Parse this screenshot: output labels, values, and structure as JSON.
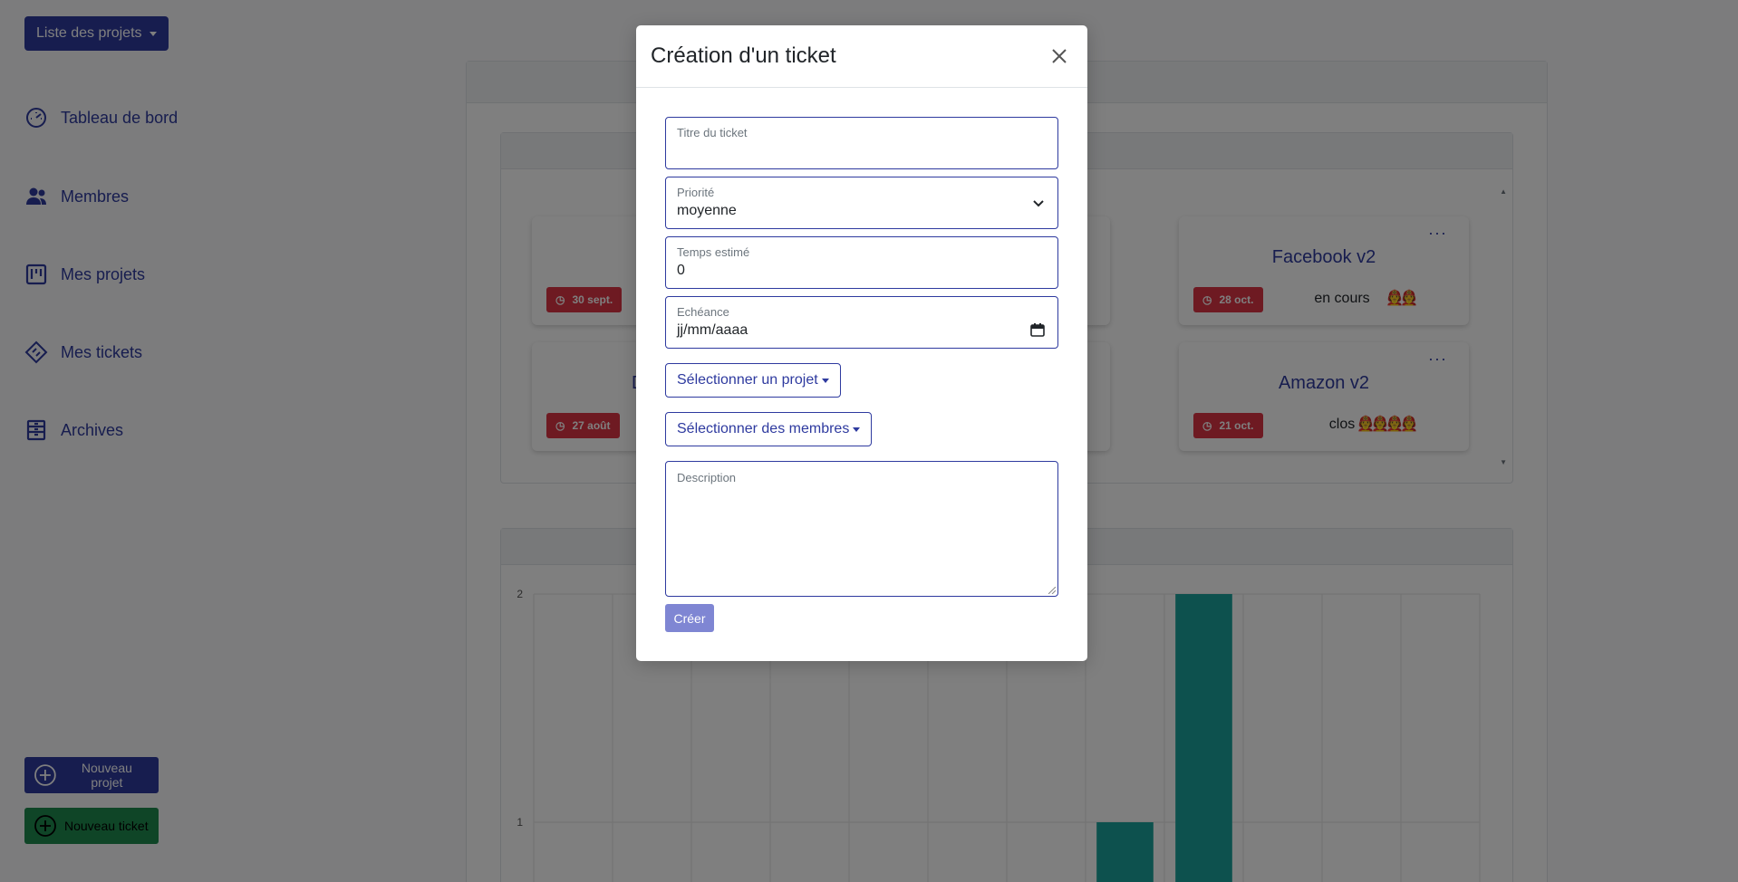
{
  "sidebar": {
    "project_dropdown": "Liste des projets",
    "items": [
      {
        "label": "Tableau de bord",
        "icon": "speedometer-icon"
      },
      {
        "label": "Membres",
        "icon": "people-icon"
      },
      {
        "label": "Mes projets",
        "icon": "kanban-icon"
      },
      {
        "label": "Mes tickets",
        "icon": "ticket-icon"
      },
      {
        "label": "Archives",
        "icon": "archive-icon"
      }
    ],
    "new_project": "Nouveau projet",
    "new_ticket": "Nouveau ticket"
  },
  "projects": [
    {
      "title": "",
      "date": "30 sept.",
      "status": "",
      "avatars": ""
    },
    {
      "title": "Facebook v2",
      "date": "28 oct.",
      "status": "en cours",
      "avatars": "🧑‍🚒🧑‍🚒"
    },
    {
      "title": "D",
      "date": "27 août",
      "status": "",
      "avatars": ""
    },
    {
      "title": "Amazon v2",
      "date": "21 oct.",
      "status": "clos",
      "avatars": "🧑‍🚒🧑‍🚒🧑‍🚒🧑‍🚒"
    }
  ],
  "chart_data": {
    "type": "bar",
    "ylim": [
      0,
      2
    ],
    "yticks": [
      "1",
      "2"
    ],
    "values": [
      0,
      0,
      0,
      0,
      0,
      0,
      0,
      1,
      2,
      0,
      0,
      0
    ],
    "color": "#1ba39c"
  },
  "modal": {
    "title": "Création d'un ticket",
    "fields": {
      "title_label": "Titre du ticket",
      "title_value": "",
      "priority_label": "Priorité",
      "priority_value": "moyenne",
      "time_label": "Temps estimé",
      "time_value": "0",
      "due_label": "Echéance",
      "due_value": "jj/mm/aaaa",
      "select_project": "Sélectionner un projet",
      "select_members": "Sélectionner des membres",
      "description_label": "Description"
    },
    "submit": "Créer"
  },
  "colors": {
    "primary": "#2e3a9f",
    "danger": "#dc3545",
    "success": "#1e8a4f",
    "bar": "#1ba39c"
  }
}
